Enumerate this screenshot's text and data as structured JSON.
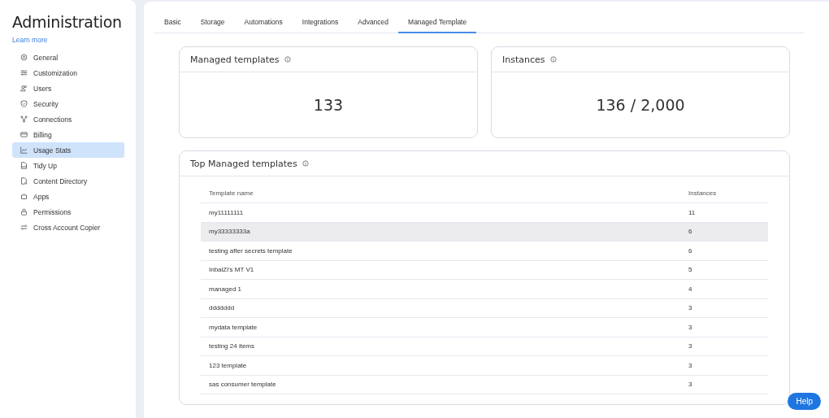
{
  "sidebar": {
    "title": "Administration",
    "learn_more": "Learn more",
    "items": [
      {
        "label": "General",
        "selected": false
      },
      {
        "label": "Customization",
        "selected": false
      },
      {
        "label": "Users",
        "selected": false
      },
      {
        "label": "Security",
        "selected": false
      },
      {
        "label": "Connections",
        "selected": false
      },
      {
        "label": "Billing",
        "selected": false
      },
      {
        "label": "Usage Stats",
        "selected": true
      },
      {
        "label": "Tidy Up",
        "selected": false
      },
      {
        "label": "Content Directory",
        "selected": false
      },
      {
        "label": "Apps",
        "selected": false
      },
      {
        "label": "Permissions",
        "selected": false
      },
      {
        "label": "Cross Account Copier",
        "selected": false
      }
    ]
  },
  "tabs": [
    {
      "label": "Basic",
      "selected": false
    },
    {
      "label": "Storage",
      "selected": false
    },
    {
      "label": "Automations",
      "selected": false
    },
    {
      "label": "Integrations",
      "selected": false
    },
    {
      "label": "Advanced",
      "selected": false
    },
    {
      "label": "Managed Template",
      "selected": true
    }
  ],
  "stats": [
    {
      "title": "Managed templates",
      "value": "133"
    },
    {
      "title": "Instances",
      "value": "136 / 2,000"
    }
  ],
  "top_table": {
    "title": "Top Managed templates",
    "columns": [
      "Template name",
      "Instances"
    ],
    "rows": [
      {
        "name": "my11111111",
        "instances": "11",
        "selected": false
      },
      {
        "name": "my33333333a",
        "instances": "6",
        "selected": true
      },
      {
        "name": "testing after secrets template",
        "instances": "6",
        "selected": false
      },
      {
        "name": "InbalZi's MT V1",
        "instances": "5",
        "selected": false
      },
      {
        "name": "managed 1",
        "instances": "4",
        "selected": false
      },
      {
        "name": "ddddddd",
        "instances": "3",
        "selected": false
      },
      {
        "name": "mydata template",
        "instances": "3",
        "selected": false
      },
      {
        "name": "testing 24 items",
        "instances": "3",
        "selected": false
      },
      {
        "name": "123 template",
        "instances": "3",
        "selected": false
      },
      {
        "name": "sas consumer template",
        "instances": "3",
        "selected": false
      }
    ]
  },
  "help_button": "Help"
}
